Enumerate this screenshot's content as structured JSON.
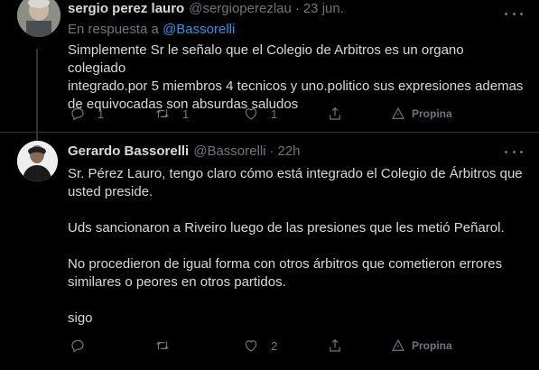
{
  "tweets": [
    {
      "name": "sergio perez lauro",
      "handle": "@sergioperezlau",
      "separator": "·",
      "time": "23 jun.",
      "reply_prefix": "En respuesta a",
      "reply_to": "@Bassorelli",
      "text": "Simplemente Sr le señalo que el Colegio de Arbitros es un organo colegiado\nintegrado.por 5 miembros 4 tecnicos y uno.politico sus expresiones ademas\nde equivocadas son absurdas saludos",
      "actions": {
        "replies": "1",
        "retweets": "1",
        "likes": "1",
        "promote_label": "Propina"
      }
    },
    {
      "name": "Gerardo Bassorelli",
      "handle": "@Bassorelli",
      "separator": "·",
      "time": "22h",
      "text": "Sr. Pérez Lauro, tengo claro cómo está integrado el Colegio de Árbitros que\nusted preside.\n\nUds sancionaron a Riveiro luego de las presiones que les metió Peñarol.\n\nNo procedieron de igual forma con otros árbitros que cometieron errores\nsimilares o peores en otros partidos.\n\nsigo",
      "actions": {
        "replies": "",
        "retweets": "",
        "likes": "2",
        "promote_label": "Propina"
      }
    }
  ],
  "icons": {
    "reply": "reply-icon",
    "retweet": "retweet-icon",
    "like": "heart-icon",
    "share": "share-icon",
    "promote": "tip-icon",
    "more": "more-icon"
  },
  "colors": {
    "background": "#000000",
    "text": "#d9d9d9",
    "muted": "#6e767d",
    "link": "#1d9bf0",
    "border": "#2f3336"
  }
}
